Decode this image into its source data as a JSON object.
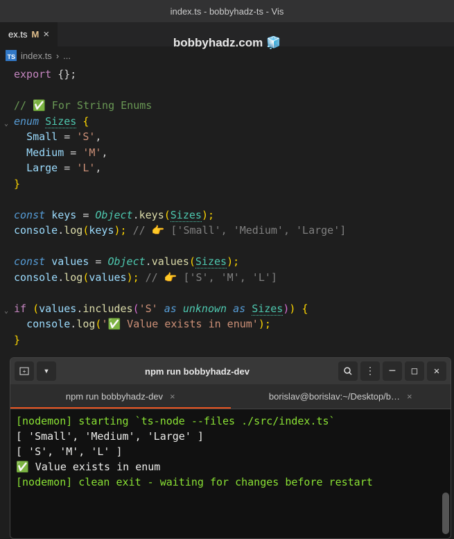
{
  "window": {
    "title": "index.ts - bobbyhadz-ts - Vis"
  },
  "overlay": {
    "text": "bobbyhadz.com 🧊"
  },
  "tab": {
    "name": "ex.ts",
    "modified": "M",
    "close": "×"
  },
  "breadcrumb": {
    "file": "index.ts",
    "sep": "›",
    "more": "..."
  },
  "code": {
    "l1": {
      "export": "export",
      "rest": " {};"
    },
    "l3": "// ✅ For String Enums",
    "l4": {
      "enum": "enum",
      "name": "Sizes",
      "brace": " {"
    },
    "l5": {
      "prop": "Small",
      "eq": " = ",
      "val": "'S'",
      "comma": ","
    },
    "l6": {
      "prop": "Medium",
      "eq": " = ",
      "val": "'M'",
      "comma": ","
    },
    "l7": {
      "prop": "Large",
      "eq": " = ",
      "val": "'L'",
      "comma": ","
    },
    "l8": "}",
    "l10": {
      "const": "const",
      "var": "keys",
      "eq": " = ",
      "obj": "Object",
      "dot": ".",
      "fn": "keys",
      "open": "(",
      "arg": "Sizes",
      "close": ");"
    },
    "l11": {
      "console": "console",
      "dot": ".",
      "log": "log",
      "open": "(",
      "arg": "keys",
      "close": "); ",
      "comment": "// 👉️ ['Small', 'Medium', 'Large']"
    },
    "l13": {
      "const": "const",
      "var": "values",
      "eq": " = ",
      "obj": "Object",
      "dot": ".",
      "fn": "values",
      "open": "(",
      "arg": "Sizes",
      "close": ");"
    },
    "l14": {
      "console": "console",
      "dot": ".",
      "log": "log",
      "open": "(",
      "arg": "values",
      "close": "); ",
      "comment": "// 👉️ ['S', 'M', 'L']"
    },
    "l16": {
      "if": "if",
      "open": " (",
      "var": "values",
      "dot": ".",
      "fn": "includes",
      "open2": "(",
      "str": "'S'",
      "as1": " as ",
      "unk": "unknown",
      "as2": " as ",
      "type": "Sizes",
      "close2": ")",
      "close": ") ",
      "brace": "{"
    },
    "l17": {
      "console": "console",
      "dot": ".",
      "log": "log",
      "open": "(",
      "str": "'✅ Value exists in enum'",
      "close": ");"
    },
    "l18": "}"
  },
  "terminal": {
    "titlebar": {
      "title": "npm run bobbyhadz-dev"
    },
    "tabs": {
      "tab1": {
        "label": "npm run bobbyhadz-dev",
        "close": "×"
      },
      "tab2": {
        "label": "borislav@borislav:~/Desktop/b…",
        "close": "×"
      }
    },
    "output": {
      "l1": "[nodemon] starting `ts-node --files ./src/index.ts`",
      "l2": "[ 'Small', 'Medium', 'Large' ]",
      "l3": "[ 'S', 'M', 'L' ]",
      "l4": "✅ Value exists in enum",
      "l5": "[nodemon] clean exit - waiting for changes before restart"
    }
  }
}
